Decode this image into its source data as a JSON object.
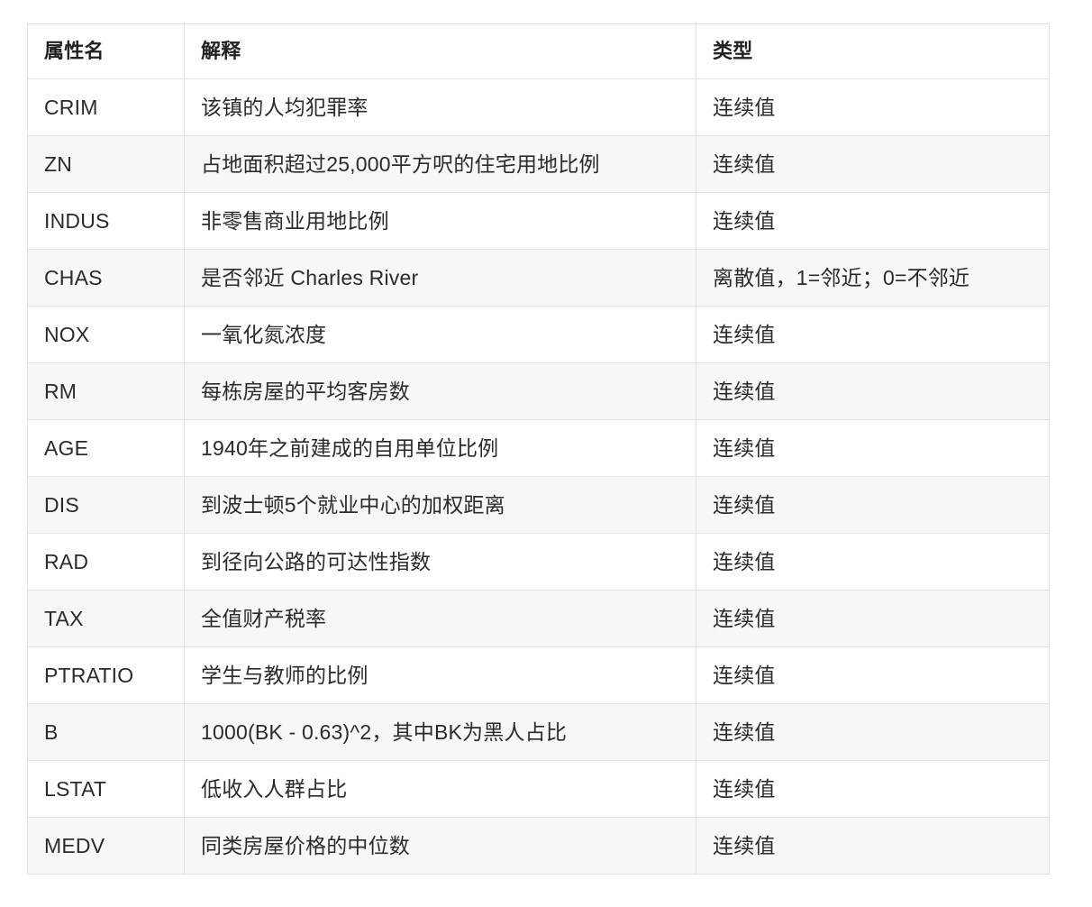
{
  "table": {
    "columns": [
      {
        "key": "name",
        "label": "属性名"
      },
      {
        "key": "desc",
        "label": "解释"
      },
      {
        "key": "type",
        "label": "类型"
      }
    ],
    "rows": [
      {
        "name": "CRIM",
        "desc": "该镇的人均犯罪率",
        "type": "连续值"
      },
      {
        "name": "ZN",
        "desc": "占地面积超过25,000平方呎的住宅用地比例",
        "type": "连续值"
      },
      {
        "name": "INDUS",
        "desc": "非零售商业用地比例",
        "type": "连续值"
      },
      {
        "name": "CHAS",
        "desc": "是否邻近 Charles River",
        "type": "离散值，1=邻近；0=不邻近"
      },
      {
        "name": "NOX",
        "desc": "一氧化氮浓度",
        "type": "连续值"
      },
      {
        "name": "RM",
        "desc": "每栋房屋的平均客房数",
        "type": "连续值"
      },
      {
        "name": "AGE",
        "desc": "1940年之前建成的自用单位比例",
        "type": "连续值"
      },
      {
        "name": "DIS",
        "desc": "到波士顿5个就业中心的加权距离",
        "type": "连续值"
      },
      {
        "name": "RAD",
        "desc": "到径向公路的可达性指数",
        "type": "连续值"
      },
      {
        "name": "TAX",
        "desc": "全值财产税率",
        "type": "连续值"
      },
      {
        "name": "PTRATIO",
        "desc": "学生与教师的比例",
        "type": "连续值"
      },
      {
        "name": "B",
        "desc": "1000(BK - 0.63)^2，其中BK为黑人占比",
        "type": "连续值"
      },
      {
        "name": "LSTAT",
        "desc": "低收入人群占比",
        "type": "连续值"
      },
      {
        "name": "MEDV",
        "desc": "同类房屋价格的中位数",
        "type": "连续值"
      }
    ]
  },
  "colors": {
    "page_background": "#ffffff",
    "row_stripe": "#f7f7f7",
    "border": "#e2e2e2",
    "text": "#2b2b2b",
    "header_text": "#222222"
  }
}
